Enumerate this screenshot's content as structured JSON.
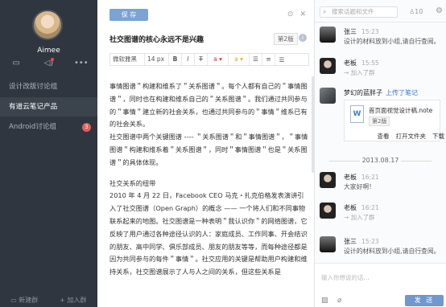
{
  "sidebar": {
    "username": "Aimee",
    "groups": [
      {
        "label": "设计改版讨论组",
        "active": false,
        "badge": ""
      },
      {
        "label": "有道云笔记产品",
        "active": true,
        "badge": ""
      },
      {
        "label": "Android讨论组",
        "active": false,
        "badge": "3"
      }
    ],
    "bottom": {
      "new_group": "新建群",
      "join_group": "加入群"
    }
  },
  "editor": {
    "save_label": "保 存",
    "title": "社交图谱的核心永远不是兴趣",
    "version": "第2版",
    "toolbar": {
      "font": "微软雅黑",
      "size": "14 px",
      "bold": "B",
      "italic": "I",
      "strike": "T",
      "color": "a",
      "highlight": "a"
    },
    "paragraphs": [
      "事情图谱＂构建和维系了＂关系图谱＂。每个人都有自己的＂事情图谱＂，同时也在构建和维系自己的＂关系图谱＂。我们通过共同参与的＂事情＂建立新的社会关系，也通过共同参与的＂事情＂维系已有的社会关系。",
      "社交图谱中两个关键图谱 ---- ＂关系图谱＂和＂事情图谱＂，＂事情图谱＂构建和维系着＂关系图谱＂，同时＂事情图谱＂也是＂关系图谱＂的具体体现。",
      "",
      "社交关系的纽带",
      "2010 年 4 月 22 日，Facebook CEO 马克・扎克伯格发表演讲引入了社交图谱（Open Graph）的概念 —— 一个将人们和不同事物联系起来的地图。社交图谱是一种表明＂我认识你＂的网络图谱，它反映了用户通过各种途径认识的人：家庭成员、工作同事、开会结识的朋友、高中同学、俱乐部成员、朋友的朋友等等，而每种途径都是因为共同参与的每件＂事情＂。社交应用的关键是帮助用户构建和维持关系，社交图谱展示了人与人之间的关系，但这些关系是"
    ]
  },
  "chat": {
    "search_placeholder": "搜索话题和文件",
    "member_count": "10",
    "messages": [
      {
        "name": "张三",
        "time": "15:23",
        "text": "设计的材料放到小组,请自行查阅。",
        "kind": "text"
      },
      {
        "name": "老板",
        "time": "15:55",
        "text": "加入了群",
        "kind": "join"
      },
      {
        "name": "梦幻的蓝胖子",
        "time": "",
        "action": "上传了笔记",
        "kind": "file",
        "file": {
          "icon": "W",
          "name": "首页面视觉设计稿.note",
          "version": "第2版",
          "actions": [
            "查看",
            "打开文件夹",
            "下载"
          ]
        }
      },
      {
        "name": "老板",
        "time": "16:21",
        "text": "大家好啊！",
        "kind": "text"
      },
      {
        "name": "老板",
        "time": "16:21",
        "text": "加入了群",
        "kind": "join"
      },
      {
        "name": "张三",
        "time": "15:23",
        "text": "设计的材料放到小组,请自行查阅。",
        "kind": "text"
      }
    ],
    "date_separator": "2013.08.17",
    "input_placeholder": "输入你想说的话...",
    "send_label": "发 送"
  }
}
